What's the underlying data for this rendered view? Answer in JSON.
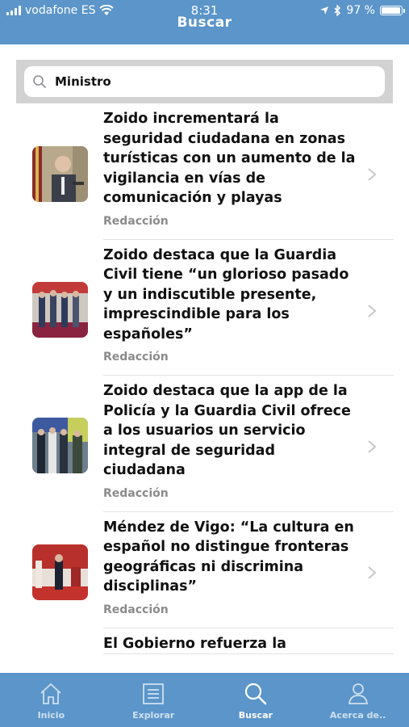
{
  "status_bar": {
    "carrier": "vodafone ES",
    "time": "8:31",
    "battery": "97 %",
    "battery_level": 0.97
  },
  "header": {
    "title": "Buscar"
  },
  "search": {
    "value": "Ministro",
    "placeholder": "Buscar"
  },
  "articles": [
    {
      "headline": "Zoido incrementará la seguridad ciudadana en zonas turísticas con un aumento de la vigilancia en vías de comunicación y playas",
      "author": "Redacción"
    },
    {
      "headline": "Zoido destaca que la Guardia Civil tiene “un glorioso pasado y un indiscutible presente, imprescindible para los españoles”",
      "author": "Redacción"
    },
    {
      "headline": "Zoido destaca que la app de la Policía y la Guardia Civil ofrece a los usuarios un servicio integral de seguridad ciudadana",
      "author": "Redacción"
    },
    {
      "headline": "Méndez de Vigo: “La cultura en español no distingue fronteras geográficas ni discrimina disciplinas”",
      "author": "Redacción"
    },
    {
      "headline": "El Gobierno refuerza la",
      "author": ""
    }
  ],
  "tabbar": {
    "tabs": [
      {
        "label": "Inicio",
        "icon": "home-icon"
      },
      {
        "label": "Explorar",
        "icon": "list-icon"
      },
      {
        "label": "Buscar",
        "icon": "search-icon"
      },
      {
        "label": "Acerca de..",
        "icon": "person-icon"
      }
    ],
    "active_tab": "Buscar"
  },
  "colors": {
    "accent": "#5b95c9",
    "search_band": "#d2d2d2",
    "muted_text": "#8b8b8b"
  }
}
